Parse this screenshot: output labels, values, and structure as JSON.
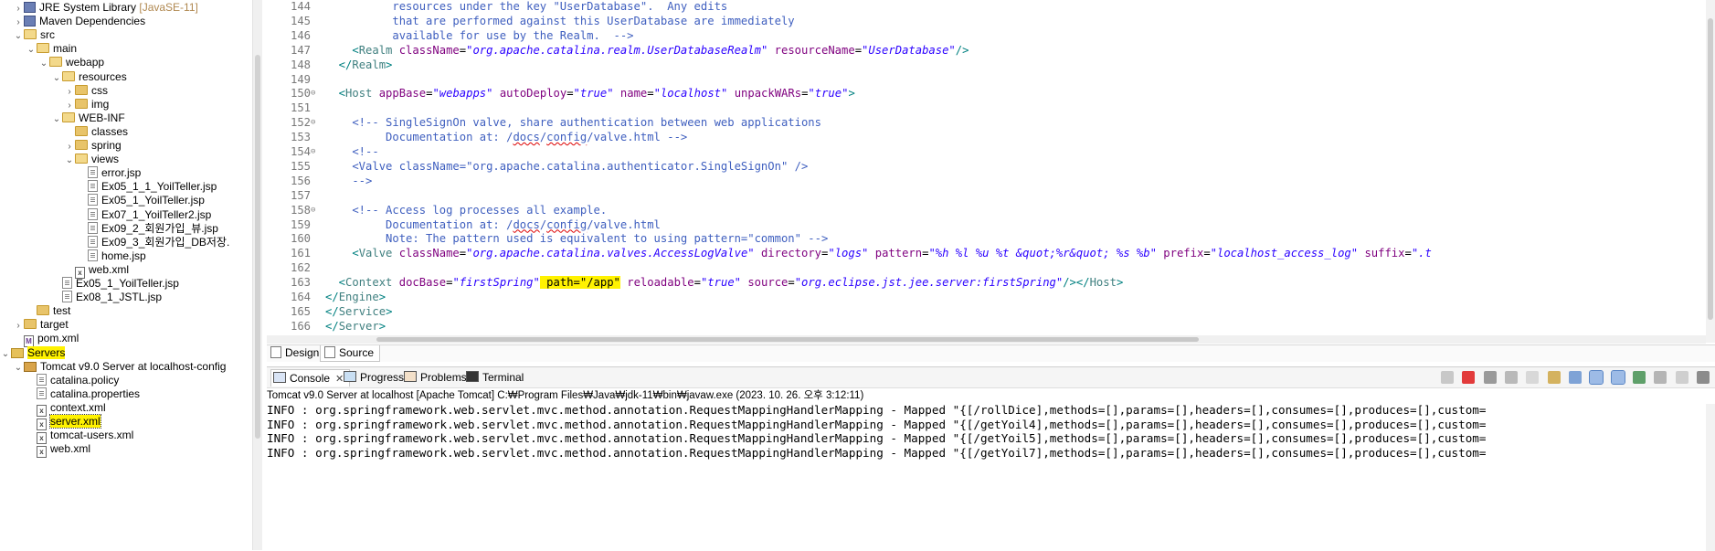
{
  "explorer": {
    "items": [
      {
        "label": "JRE System Library",
        "suffix": "[JavaSE-11]",
        "icon": "library-icon",
        "arrow": "›",
        "indent": 0
      },
      {
        "label": "Maven Dependencies",
        "icon": "library-icon",
        "arrow": "›",
        "indent": 0
      },
      {
        "label": "src",
        "icon": "folder-open-icon",
        "arrow": "⌄",
        "indent": 0
      },
      {
        "label": "main",
        "icon": "folder-open-icon",
        "arrow": "⌄",
        "indent": 1
      },
      {
        "label": "webapp",
        "icon": "folder-open-icon",
        "arrow": "⌄",
        "indent": 2
      },
      {
        "label": "resources",
        "icon": "folder-open-icon",
        "arrow": "⌄",
        "indent": 3
      },
      {
        "label": "css",
        "icon": "folder-icon",
        "arrow": "›",
        "indent": 4
      },
      {
        "label": "img",
        "icon": "folder-icon",
        "arrow": "›",
        "indent": 4
      },
      {
        "label": "WEB-INF",
        "icon": "folder-open-icon",
        "arrow": "⌄",
        "indent": 3
      },
      {
        "label": "classes",
        "icon": "folder-icon",
        "arrow": "",
        "indent": 4
      },
      {
        "label": "spring",
        "icon": "folder-icon",
        "arrow": "›",
        "indent": 4
      },
      {
        "label": "views",
        "icon": "folder-open-icon",
        "arrow": "⌄",
        "indent": 4
      },
      {
        "label": "error.jsp",
        "icon": "jsp-file-icon",
        "arrow": "",
        "indent": 5
      },
      {
        "label": "Ex05_1_1_YoilTeller.jsp",
        "icon": "jsp-file-icon",
        "arrow": "",
        "indent": 5
      },
      {
        "label": "Ex05_1_YoilTeller.jsp",
        "icon": "jsp-file-icon",
        "arrow": "",
        "indent": 5
      },
      {
        "label": "Ex07_1_YoilTeller2.jsp",
        "icon": "jsp-file-icon",
        "arrow": "",
        "indent": 5
      },
      {
        "label": "Ex09_2_회원가입_뷰.jsp",
        "icon": "jsp-file-icon",
        "arrow": "",
        "indent": 5
      },
      {
        "label": "Ex09_3_회원가입_DB저장.",
        "icon": "jsp-file-icon",
        "arrow": "",
        "indent": 5
      },
      {
        "label": "home.jsp",
        "icon": "jsp-file-icon",
        "arrow": "",
        "indent": 5
      },
      {
        "label": "web.xml",
        "icon": "xml-file-icon",
        "arrow": "",
        "indent": 4
      },
      {
        "label": "Ex05_1_YoilTeller.jsp",
        "icon": "jsp-file-icon",
        "arrow": "",
        "indent": 3
      },
      {
        "label": "Ex08_1_JSTL.jsp",
        "icon": "jsp-file-icon",
        "arrow": "",
        "indent": 3
      },
      {
        "label": "test",
        "icon": "folder-icon",
        "arrow": "",
        "indent": 1
      },
      {
        "label": "target",
        "icon": "folder-icon",
        "arrow": "›",
        "indent": 0
      },
      {
        "label": "pom.xml",
        "icon": "pom-file-icon",
        "arrow": "",
        "indent": 0
      },
      {
        "label": "Servers",
        "icon": "servers-folder-icon",
        "arrow": "⌄",
        "indent": -1,
        "highlight": true
      },
      {
        "label": "Tomcat v9.0 Server at localhost-config",
        "icon": "tomcat-folder-icon",
        "arrow": "⌄",
        "indent": 0
      },
      {
        "label": "catalina.policy",
        "icon": "plain-file-icon",
        "arrow": "",
        "indent": 1
      },
      {
        "label": "catalina.properties",
        "icon": "plain-file-icon",
        "arrow": "",
        "indent": 1
      },
      {
        "label": "context.xml",
        "icon": "xml-file-icon",
        "arrow": "",
        "indent": 1
      },
      {
        "label": "server.xml",
        "icon": "xml-file-icon",
        "arrow": "",
        "indent": 1,
        "highlight": true,
        "selected": true
      },
      {
        "label": "tomcat-users.xml",
        "icon": "xml-file-icon",
        "arrow": "",
        "indent": 1
      },
      {
        "label": "web.xml",
        "icon": "xml-file-icon",
        "arrow": "",
        "indent": 1
      }
    ]
  },
  "editor": {
    "lines": [
      {
        "n": "144",
        "fold": "",
        "segs": [
          [
            "cmt",
            "          resources under the key \"UserDatabase\".  Any edits"
          ]
        ]
      },
      {
        "n": "145",
        "fold": "",
        "segs": [
          [
            "cmt",
            "          that are performed against this UserDatabase are immediately"
          ]
        ]
      },
      {
        "n": "146",
        "fold": "",
        "segs": [
          [
            "cmt",
            "          available for use by the Realm.  -->"
          ]
        ]
      },
      {
        "n": "147",
        "fold": "",
        "segs": [
          [
            "punct",
            "    <"
          ],
          [
            "tag",
            "Realm"
          ],
          [
            "txt",
            " "
          ],
          [
            "attr",
            "className"
          ],
          [
            "txt",
            "="
          ],
          [
            "val",
            "\"org.apache.catalina.realm.UserDatabaseRealm\""
          ],
          [
            "txt",
            " "
          ],
          [
            "attr",
            "resourceName"
          ],
          [
            "txt",
            "="
          ],
          [
            "val",
            "\"UserDatabase\""
          ],
          [
            "punct",
            "/>"
          ]
        ]
      },
      {
        "n": "148",
        "fold": "",
        "segs": [
          [
            "punct",
            "  </"
          ],
          [
            "tag",
            "Realm"
          ],
          [
            "punct",
            ">"
          ]
        ]
      },
      {
        "n": "149",
        "fold": "",
        "segs": []
      },
      {
        "n": "150",
        "fold": "⊖",
        "segs": [
          [
            "punct",
            "  <"
          ],
          [
            "tag",
            "Host"
          ],
          [
            "txt",
            " "
          ],
          [
            "attr",
            "appBase"
          ],
          [
            "txt",
            "="
          ],
          [
            "val",
            "\"webapps\""
          ],
          [
            "txt",
            " "
          ],
          [
            "attr",
            "autoDeploy"
          ],
          [
            "txt",
            "="
          ],
          [
            "val",
            "\"true\""
          ],
          [
            "txt",
            " "
          ],
          [
            "attr",
            "name"
          ],
          [
            "txt",
            "="
          ],
          [
            "val",
            "\"localhost\""
          ],
          [
            "txt",
            " "
          ],
          [
            "attr",
            "unpackWARs"
          ],
          [
            "txt",
            "="
          ],
          [
            "val",
            "\"true\""
          ],
          [
            "punct",
            ">"
          ]
        ]
      },
      {
        "n": "151",
        "fold": "",
        "segs": []
      },
      {
        "n": "152",
        "fold": "⊖",
        "segs": [
          [
            "cmt",
            "    <!-- SingleSignOn valve, share authentication between web applications"
          ]
        ]
      },
      {
        "n": "153",
        "fold": "",
        "segs": [
          [
            "cmt",
            "         Documentation at: /"
          ],
          [
            "cmtspell",
            "docs"
          ],
          [
            "cmt",
            "/"
          ],
          [
            "cmtspell",
            "config"
          ],
          [
            "cmt",
            "/valve.html -->"
          ]
        ]
      },
      {
        "n": "154",
        "fold": "⊖",
        "segs": [
          [
            "cmt",
            "    <!--"
          ]
        ]
      },
      {
        "n": "155",
        "fold": "",
        "segs": [
          [
            "cmt",
            "    <Valve className=\"org.apache.catalina.authenticator.SingleSignOn\" />"
          ]
        ]
      },
      {
        "n": "156",
        "fold": "",
        "segs": [
          [
            "cmt",
            "    -->"
          ]
        ]
      },
      {
        "n": "157",
        "fold": "",
        "segs": []
      },
      {
        "n": "158",
        "fold": "⊖",
        "segs": [
          [
            "cmt",
            "    <!-- Access log processes all example."
          ]
        ]
      },
      {
        "n": "159",
        "fold": "",
        "segs": [
          [
            "cmt",
            "         Documentation at: /"
          ],
          [
            "cmtspell",
            "docs"
          ],
          [
            "cmt",
            "/"
          ],
          [
            "cmtspell",
            "config"
          ],
          [
            "cmt",
            "/valve.html"
          ]
        ]
      },
      {
        "n": "160",
        "fold": "",
        "segs": [
          [
            "cmt",
            "         Note: The pattern used is equivalent to using pattern=\"common\" -->"
          ]
        ]
      },
      {
        "n": "161",
        "fold": "",
        "segs": [
          [
            "punct",
            "    <"
          ],
          [
            "tag",
            "Valve"
          ],
          [
            "txt",
            " "
          ],
          [
            "attr",
            "className"
          ],
          [
            "txt",
            "="
          ],
          [
            "val",
            "\"org.apache.catalina.valves.AccessLogValve\""
          ],
          [
            "txt",
            " "
          ],
          [
            "attr",
            "directory"
          ],
          [
            "txt",
            "="
          ],
          [
            "val",
            "\"logs\""
          ],
          [
            "txt",
            " "
          ],
          [
            "attr",
            "pattern"
          ],
          [
            "txt",
            "="
          ],
          [
            "val",
            "\"%h %l %u %t &quot;%r&quot; %s %b\""
          ],
          [
            "txt",
            " "
          ],
          [
            "attr",
            "prefix"
          ],
          [
            "txt",
            "="
          ],
          [
            "val",
            "\"localhost_access_log\""
          ],
          [
            "txt",
            " "
          ],
          [
            "attr",
            "suffix"
          ],
          [
            "txt",
            "="
          ],
          [
            "val",
            "\".t"
          ]
        ]
      },
      {
        "n": "162",
        "fold": "",
        "segs": []
      },
      {
        "n": "163",
        "fold": "",
        "segs": [
          [
            "punct",
            "  <"
          ],
          [
            "tag",
            "Context"
          ],
          [
            "txt",
            " "
          ],
          [
            "attr",
            "docBase"
          ],
          [
            "txt",
            "="
          ],
          [
            "val",
            "\"firstSpring\""
          ],
          [
            "pathhl",
            " path=\"/app\""
          ],
          [
            "txt",
            " "
          ],
          [
            "attr",
            "reloadable"
          ],
          [
            "txt",
            "="
          ],
          [
            "val",
            "\"true\""
          ],
          [
            "txt",
            " "
          ],
          [
            "attr",
            "source"
          ],
          [
            "txt",
            "="
          ],
          [
            "val",
            "\"org.eclipse.jst.jee.server:firstSpring\""
          ],
          [
            "punct",
            "/></"
          ],
          [
            "tag",
            "Host"
          ],
          [
            "punct",
            ">"
          ]
        ]
      },
      {
        "n": "164",
        "fold": "",
        "segs": [
          [
            "punct",
            "</"
          ],
          [
            "tag",
            "Engine"
          ],
          [
            "punct",
            ">"
          ]
        ]
      },
      {
        "n": "165",
        "fold": "",
        "segs": [
          [
            "punct",
            "</"
          ],
          [
            "tag",
            "Service"
          ],
          [
            "punct",
            ">"
          ]
        ]
      },
      {
        "n": "166",
        "fold": "",
        "segs": [
          [
            "punct",
            "</"
          ],
          [
            "tag",
            "Server"
          ],
          [
            "punct",
            ">"
          ]
        ]
      }
    ],
    "tabs": {
      "design": "Design",
      "source": "Source"
    }
  },
  "console": {
    "tabs": {
      "console": "Console",
      "progress": "Progress",
      "problems": "Problems",
      "terminal": "Terminal"
    },
    "description": "Tomcat v9.0 Server at localhost [Apache Tomcat] C:₩Program Files₩Java₩jdk-11₩bin₩javaw.exe  (2023. 10. 26. 오후 3:12:11)",
    "lines": [
      "INFO : org.springframework.web.servlet.mvc.method.annotation.RequestMappingHandlerMapping - Mapped \"{[/rollDice],methods=[],params=[],headers=[],consumes=[],produces=[],custom=",
      "INFO : org.springframework.web.servlet.mvc.method.annotation.RequestMappingHandlerMapping - Mapped \"{[/getYoil4],methods=[],params=[],headers=[],consumes=[],produces=[],custom=",
      "INFO : org.springframework.web.servlet.mvc.method.annotation.RequestMappingHandlerMapping - Mapped \"{[/getYoil5],methods=[],params=[],headers=[],consumes=[],produces=[],custom=",
      "INFO : org.springframework.web.servlet.mvc.method.annotation.RequestMappingHandlerMapping - Mapped \"{[/getYoil7],methods=[],params=[],headers=[],consumes=[],produces=[],custom="
    ]
  },
  "colors": {
    "highlight": "#fff200",
    "tag": "#3f7f7f",
    "attr": "#7f007f",
    "value": "#2a00ff",
    "comment": "#3f5fbf"
  }
}
